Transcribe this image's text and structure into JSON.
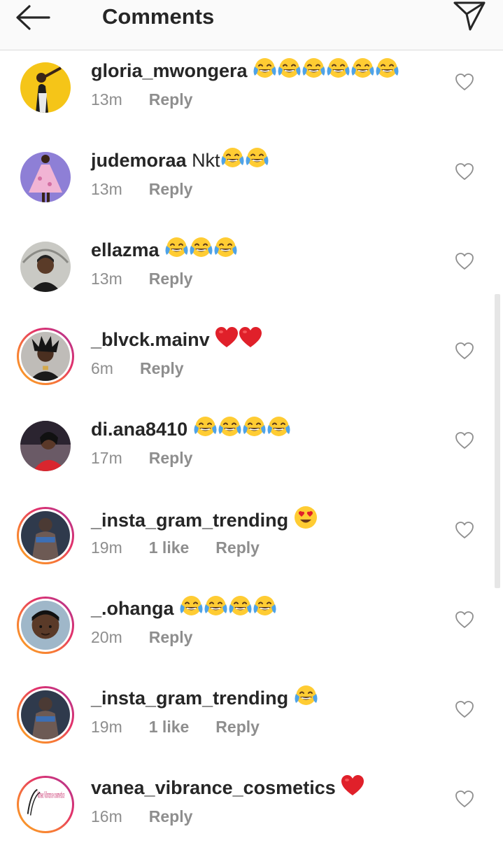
{
  "header": {
    "title": "Comments",
    "back_icon": "arrow-left-icon",
    "send_icon": "paper-plane-icon"
  },
  "colors": {
    "text": "#262626",
    "meta": "#8e8e8e",
    "story_ring": [
      "#f9a825",
      "#e1306c",
      "#833ab4"
    ],
    "heart": "#e0202a"
  },
  "comments": [
    {
      "username": "gloria_mwongera",
      "text": "",
      "emojis": [
        "face-with-tears-of-joy",
        "face-with-tears-of-joy",
        "face-with-tears-of-joy",
        "face-with-tears-of-joy",
        "face-with-tears-of-joy",
        "face-with-tears-of-joy"
      ],
      "time": "13m",
      "likes": "",
      "reply": "Reply",
      "story_ring": false
    },
    {
      "username": "judemoraa",
      "text": "Nkt",
      "emojis": [
        "face-with-tears-of-joy",
        "face-with-tears-of-joy"
      ],
      "time": "13m",
      "likes": "",
      "reply": "Reply",
      "story_ring": false
    },
    {
      "username": "ellazma",
      "text": "",
      "emojis": [
        "face-with-tears-of-joy",
        "face-with-tears-of-joy",
        "face-with-tears-of-joy"
      ],
      "time": "13m",
      "likes": "",
      "reply": "Reply",
      "story_ring": false
    },
    {
      "username": "_blvck.mainv",
      "text": "",
      "emojis": [
        "red-heart",
        "red-heart"
      ],
      "time": "6m",
      "likes": "",
      "reply": "Reply",
      "story_ring": true
    },
    {
      "username": "di.ana8410",
      "text": "",
      "emojis": [
        "face-with-tears-of-joy",
        "face-with-tears-of-joy",
        "face-with-tears-of-joy",
        "face-with-tears-of-joy"
      ],
      "time": "17m",
      "likes": "",
      "reply": "Reply",
      "story_ring": false
    },
    {
      "username": "_insta_gram_trending",
      "text": "",
      "emojis": [
        "heart-eyes-face"
      ],
      "time": "19m",
      "likes": "1 like",
      "reply": "Reply",
      "story_ring": true
    },
    {
      "username": "_.ohanga",
      "text": "",
      "emojis": [
        "face-with-tears-of-joy",
        "face-with-tears-of-joy",
        "face-with-tears-of-joy",
        "face-with-tears-of-joy"
      ],
      "time": "20m",
      "likes": "",
      "reply": "Reply",
      "story_ring": true
    },
    {
      "username": "_insta_gram_trending",
      "text": "",
      "emojis": [
        "face-with-tears-of-joy"
      ],
      "time": "19m",
      "likes": "1 like",
      "reply": "Reply",
      "story_ring": true
    },
    {
      "username": "vanea_vibrance_cosmetics",
      "text": "",
      "emojis": [
        "red-heart"
      ],
      "time": "16m",
      "likes": "",
      "reply": "Reply",
      "story_ring": true
    }
  ],
  "vanea_logo_text": "Vanea Vibrance cosmetics"
}
